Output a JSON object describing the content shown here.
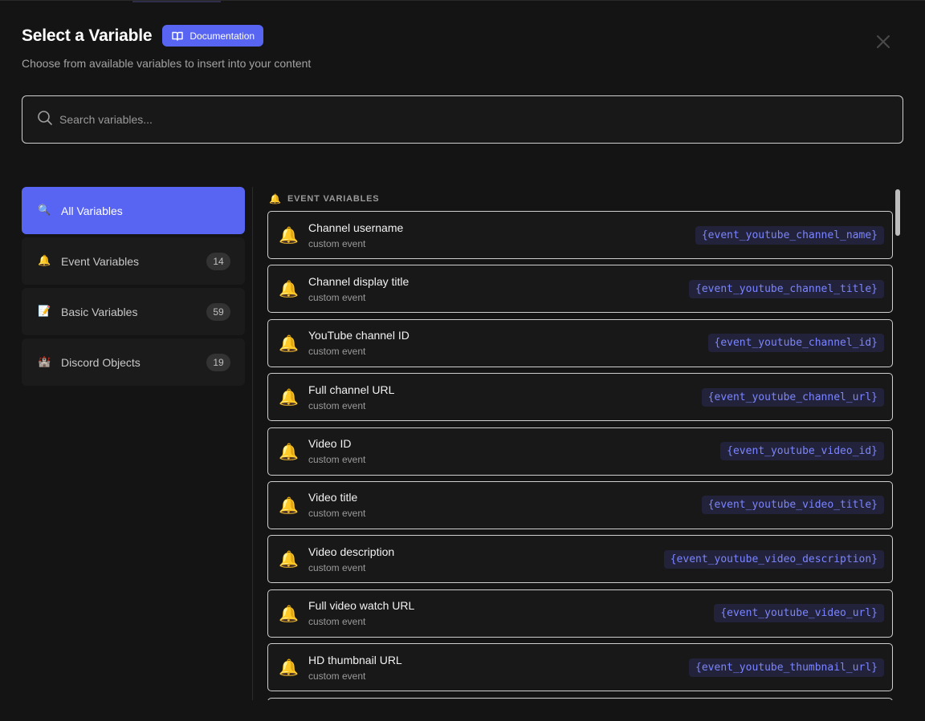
{
  "modal": {
    "title": "Select a Variable",
    "doc_button": "Documentation",
    "subtitle": "Choose from available variables to insert into your content",
    "close_icon": "close-icon"
  },
  "search": {
    "placeholder": "Search variables...",
    "icon": "search-icon"
  },
  "sidebar": {
    "items": [
      {
        "emoji": "🔍",
        "label": "All Variables",
        "count": "",
        "active": true
      },
      {
        "emoji": "🔔",
        "label": "Event Variables",
        "count": "14",
        "active": false
      },
      {
        "emoji": "📝",
        "label": "Basic Variables",
        "count": "59",
        "active": false
      },
      {
        "emoji": "🏰",
        "label": "Discord Objects",
        "count": "19",
        "active": false
      }
    ]
  },
  "section": {
    "emoji": "🔔",
    "title": "EVENT VARIABLES"
  },
  "variables": [
    {
      "emoji": "🔔",
      "name": "Channel username",
      "sub": "custom event",
      "code": "{event_youtube_channel_name}"
    },
    {
      "emoji": "🔔",
      "name": "Channel display title",
      "sub": "custom event",
      "code": "{event_youtube_channel_title}"
    },
    {
      "emoji": "🔔",
      "name": "YouTube channel ID",
      "sub": "custom event",
      "code": "{event_youtube_channel_id}"
    },
    {
      "emoji": "🔔",
      "name": "Full channel URL",
      "sub": "custom event",
      "code": "{event_youtube_channel_url}"
    },
    {
      "emoji": "🔔",
      "name": "Video ID",
      "sub": "custom event",
      "code": "{event_youtube_video_id}"
    },
    {
      "emoji": "🔔",
      "name": "Video title",
      "sub": "custom event",
      "code": "{event_youtube_video_title}"
    },
    {
      "emoji": "🔔",
      "name": "Video description",
      "sub": "custom event",
      "code": "{event_youtube_video_description}"
    },
    {
      "emoji": "🔔",
      "name": "Full video watch URL",
      "sub": "custom event",
      "code": "{event_youtube_video_url}"
    },
    {
      "emoji": "🔔",
      "name": "HD thumbnail URL",
      "sub": "custom event",
      "code": "{event_youtube_thumbnail_url}"
    },
    {
      "emoji": "",
      "name": "",
      "sub": "",
      "code": ""
    }
  ],
  "colors": {
    "accent": "#5865f2",
    "code_text": "#7b85ff",
    "code_bg": "#22223a",
    "background": "#141414"
  }
}
